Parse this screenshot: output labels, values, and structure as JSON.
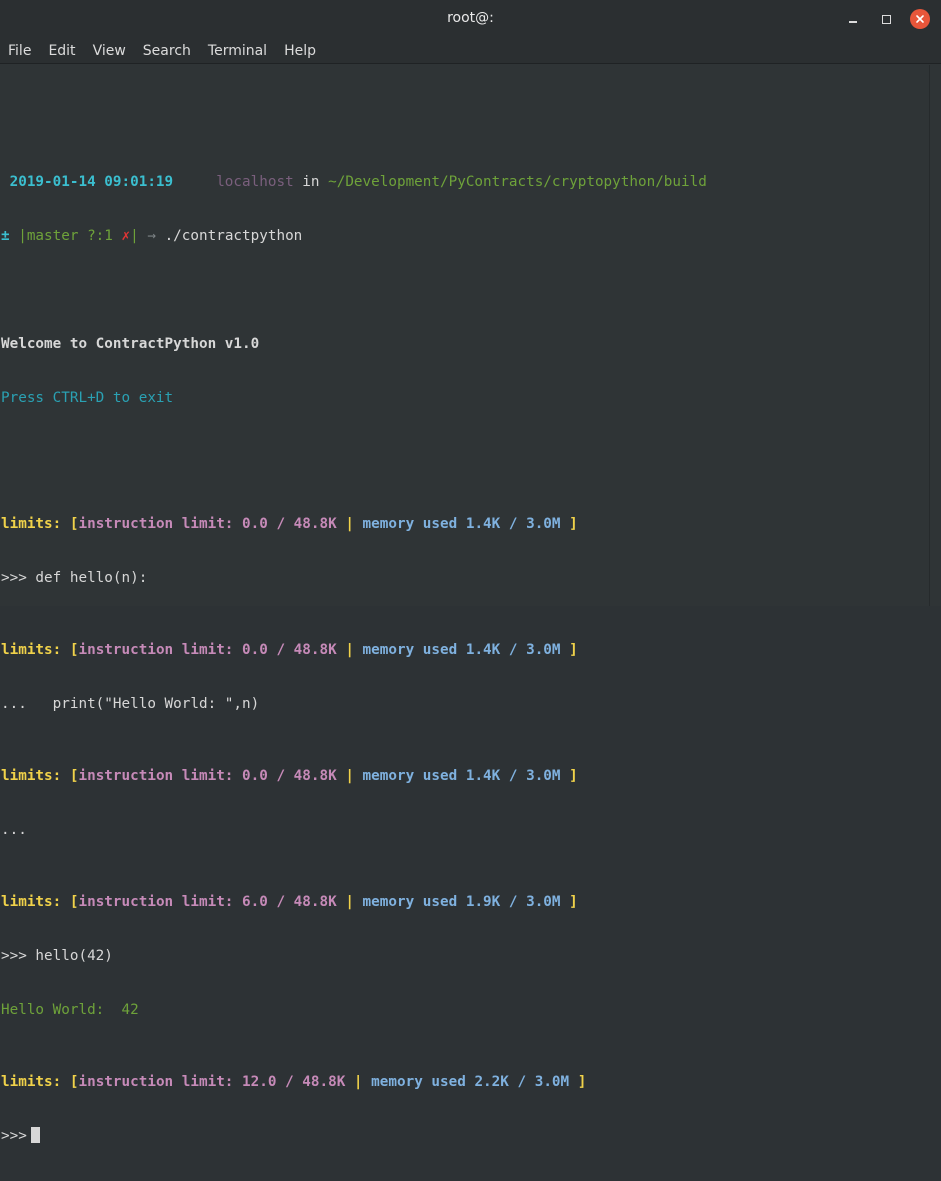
{
  "window": {
    "title": "root@:"
  },
  "menu": [
    "File",
    "Edit",
    "View",
    "Search",
    "Terminal",
    "Help"
  ],
  "prompt": {
    "datetime": " 2019-01-14 09:01:19",
    "host": "localhost",
    "in": "in",
    "path": "~/Development/PyContracts/cryptopython/build",
    "git_symbol": "±",
    "branch": " |master ?:1 ",
    "dirty": "✗",
    "branch_end": "|",
    "arrow": " → ",
    "command": "./contractpython"
  },
  "output": {
    "welcome": "Welcome to ContractPython v1.0",
    "exit_hint": "Press CTRL+D to exit",
    "limits_label": "limits:",
    "instruction_label": "instruction limit:",
    "memory_label": "memory used",
    "lines": [
      {
        "instr": "0.0 / 48.8K",
        "mem": "1.4K / 3.0M"
      },
      {
        "instr": "0.0 / 48.8K",
        "mem": "1.4K / 3.0M"
      },
      {
        "instr": "0.0 / 48.8K",
        "mem": "1.4K / 3.0M"
      },
      {
        "instr": "6.0 / 48.8K",
        "mem": "1.9K / 3.0M"
      },
      {
        "instr": "12.0 / 48.8K",
        "mem": "2.2K / 3.0M"
      }
    ],
    "repl": {
      "line1": ">>> def hello(n):",
      "line2": "...   print(\"Hello World: \",n)",
      "line3": "...",
      "line4": ">>> hello(42)",
      "result": "Hello World:  42",
      "final_prompt": ">>>"
    }
  }
}
